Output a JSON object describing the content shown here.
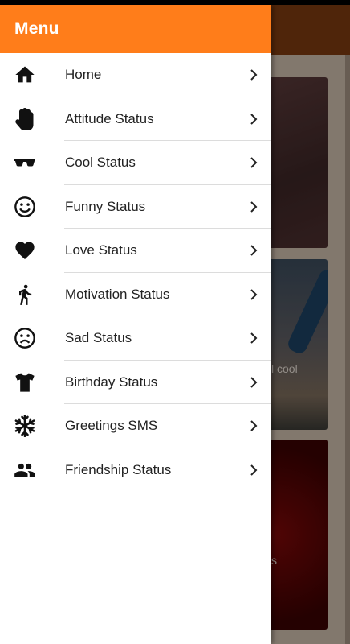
{
  "drawer": {
    "title": "Menu",
    "items": [
      {
        "label": "Home",
        "icon": "home-icon"
      },
      {
        "label": "Attitude Status",
        "icon": "hand-icon"
      },
      {
        "label": "Cool Status",
        "icon": "sunglasses-icon"
      },
      {
        "label": "Funny Status",
        "icon": "smile-icon"
      },
      {
        "label": "Love Status",
        "icon": "heart-icon"
      },
      {
        "label": "Motivation Status",
        "icon": "walking-icon"
      },
      {
        "label": "Sad Status",
        "icon": "sad-face-icon"
      },
      {
        "label": "Birthday Status",
        "icon": "tshirt-icon"
      },
      {
        "label": "Greetings SMS",
        "icon": "snowflake-icon"
      },
      {
        "label": "Friendship Status",
        "icon": "people-icon"
      }
    ]
  },
  "background": {
    "card2_text": "l cool",
    "card3_text": "s"
  },
  "colors": {
    "header": "#ff7d1a",
    "divider": "#dcdcdc"
  }
}
